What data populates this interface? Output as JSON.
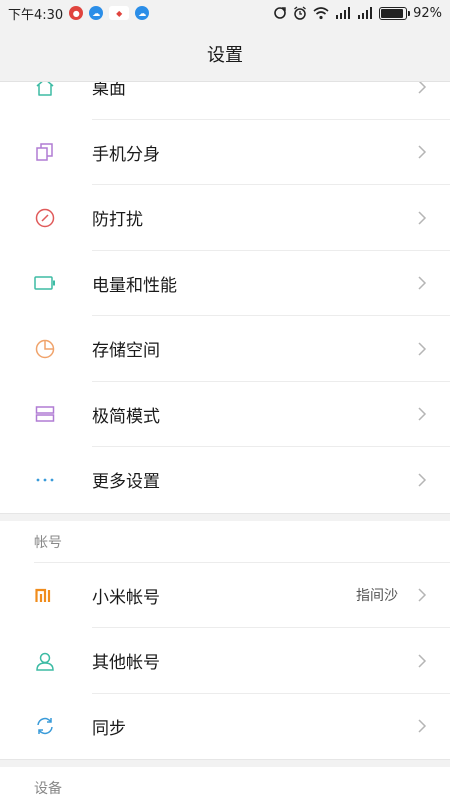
{
  "status_bar": {
    "time": "下午4:30",
    "battery": "92%",
    "battery_level": 0.92,
    "notification_icons": [
      "weibo-red-icon",
      "cloud-icon",
      "weibo-tag-icon",
      "cloud-icon"
    ],
    "system_icons": [
      "sync-icon",
      "alarm-icon",
      "wifi-icon",
      "signal-icon",
      "signal-icon",
      "battery-icon"
    ]
  },
  "header": {
    "title": "设置"
  },
  "colors": {
    "teal": "#3dbba4",
    "purple": "#b07cd4",
    "red": "#e05a5a",
    "orange": "#f0a36b",
    "blue": "#3a9bd9",
    "mi_orange": "#f08c1c"
  },
  "group1": {
    "items": [
      {
        "label": "桌面",
        "icon": "home-icon"
      },
      {
        "label": "手机分身",
        "icon": "clone-icon"
      },
      {
        "label": "防打扰",
        "icon": "do-not-disturb-icon"
      },
      {
        "label": "电量和性能",
        "icon": "battery-outline-icon"
      },
      {
        "label": "存储空间",
        "icon": "pie-icon"
      },
      {
        "label": "极简模式",
        "icon": "layout-icon"
      },
      {
        "label": "更多设置",
        "icon": "more-dots-icon"
      }
    ]
  },
  "accounts": {
    "header": "帐号",
    "items": [
      {
        "label": "小米帐号",
        "value": "指间沙",
        "icon": "mi-logo-icon"
      },
      {
        "label": "其他帐号",
        "icon": "person-icon"
      },
      {
        "label": "同步",
        "icon": "sync-arrows-icon"
      }
    ]
  },
  "devices": {
    "header": "设备"
  }
}
